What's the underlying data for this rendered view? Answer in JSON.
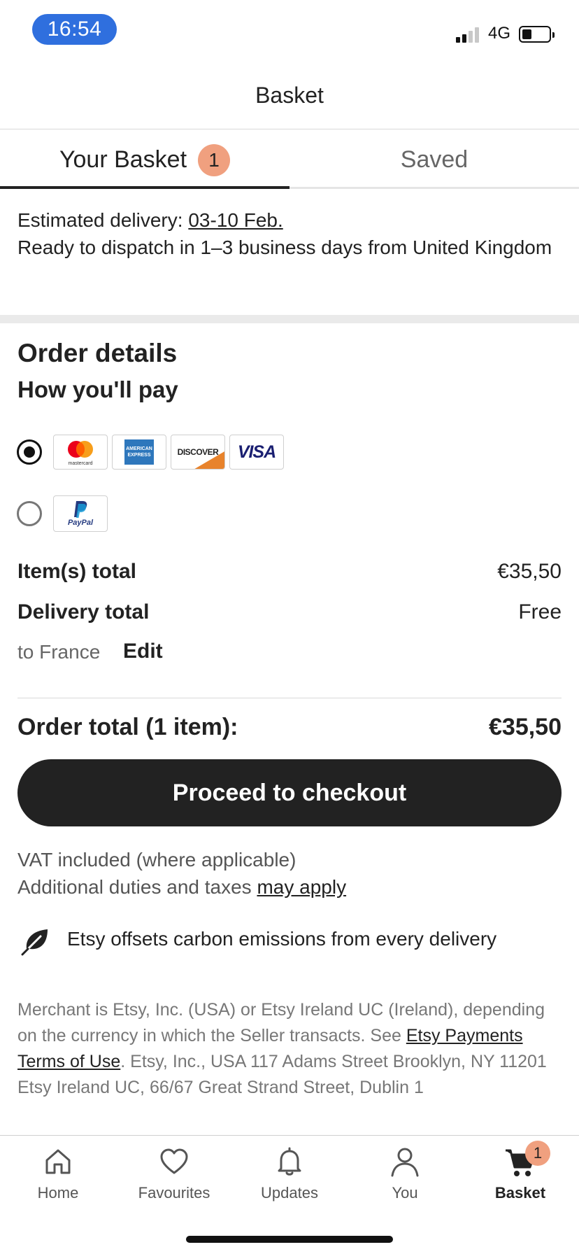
{
  "status_bar": {
    "time": "16:54",
    "network": "4G"
  },
  "header": {
    "title": "Basket"
  },
  "tabs": [
    {
      "label": "Your Basket",
      "badge": "1",
      "active": true
    },
    {
      "label": "Saved",
      "active": false
    }
  ],
  "delivery": {
    "estimated_prefix": "Estimated delivery: ",
    "estimated_dates": "03-10 Feb.",
    "dispatch_text": "Ready to dispatch in 1–3 business days from United Kingdom"
  },
  "order": {
    "title": "Order details",
    "pay_title": "How you'll pay",
    "payment_options": [
      {
        "id": "cards",
        "selected": true,
        "cards": [
          "mastercard",
          "american-express",
          "discover",
          "visa"
        ]
      },
      {
        "id": "paypal",
        "selected": false,
        "cards": [
          "paypal"
        ]
      }
    ],
    "card_text": {
      "mastercard": "mastercard",
      "amex_line1": "AMERICAN",
      "amex_line2": "EXPRESS",
      "discover": "DISCOVER",
      "visa": "VISA",
      "paypal": "PayPal"
    },
    "items_total_label": "Item(s) total",
    "items_total_value": "€35,50",
    "delivery_total_label": "Delivery total",
    "delivery_total_value": "Free",
    "destination": "to France",
    "edit_label": "Edit",
    "order_total_label": "Order total (1 item):",
    "order_total_value": "€35,50",
    "checkout_label": "Proceed to checkout"
  },
  "tax": {
    "vat_line": "VAT included (where applicable)",
    "duties_prefix": "Additional duties and taxes ",
    "duties_link": "may apply"
  },
  "carbon": {
    "text": "Etsy offsets carbon emissions from every delivery",
    "icon": "leaf-icon"
  },
  "legal": {
    "part1": "Merchant is Etsy, Inc. (USA) or Etsy Ireland UC (Ireland), depending on the currency in which the Seller transacts. See ",
    "link": "Etsy Payments Terms of Use",
    "part2": ". Etsy, Inc., USA 117 Adams Street Brooklyn, NY 11201 Etsy Ireland UC, 66/67 Great Strand Street, Dublin 1"
  },
  "bottom_nav": [
    {
      "label": "Home",
      "icon": "home-icon"
    },
    {
      "label": "Favourites",
      "icon": "heart-icon"
    },
    {
      "label": "Updates",
      "icon": "bell-icon"
    },
    {
      "label": "You",
      "icon": "user-icon"
    },
    {
      "label": "Basket",
      "icon": "cart-icon",
      "badge": "1",
      "active": true
    }
  ],
  "colors": {
    "accent_badge": "#f0a07f",
    "primary_button": "#222222",
    "time_pill": "#2f6fde"
  }
}
